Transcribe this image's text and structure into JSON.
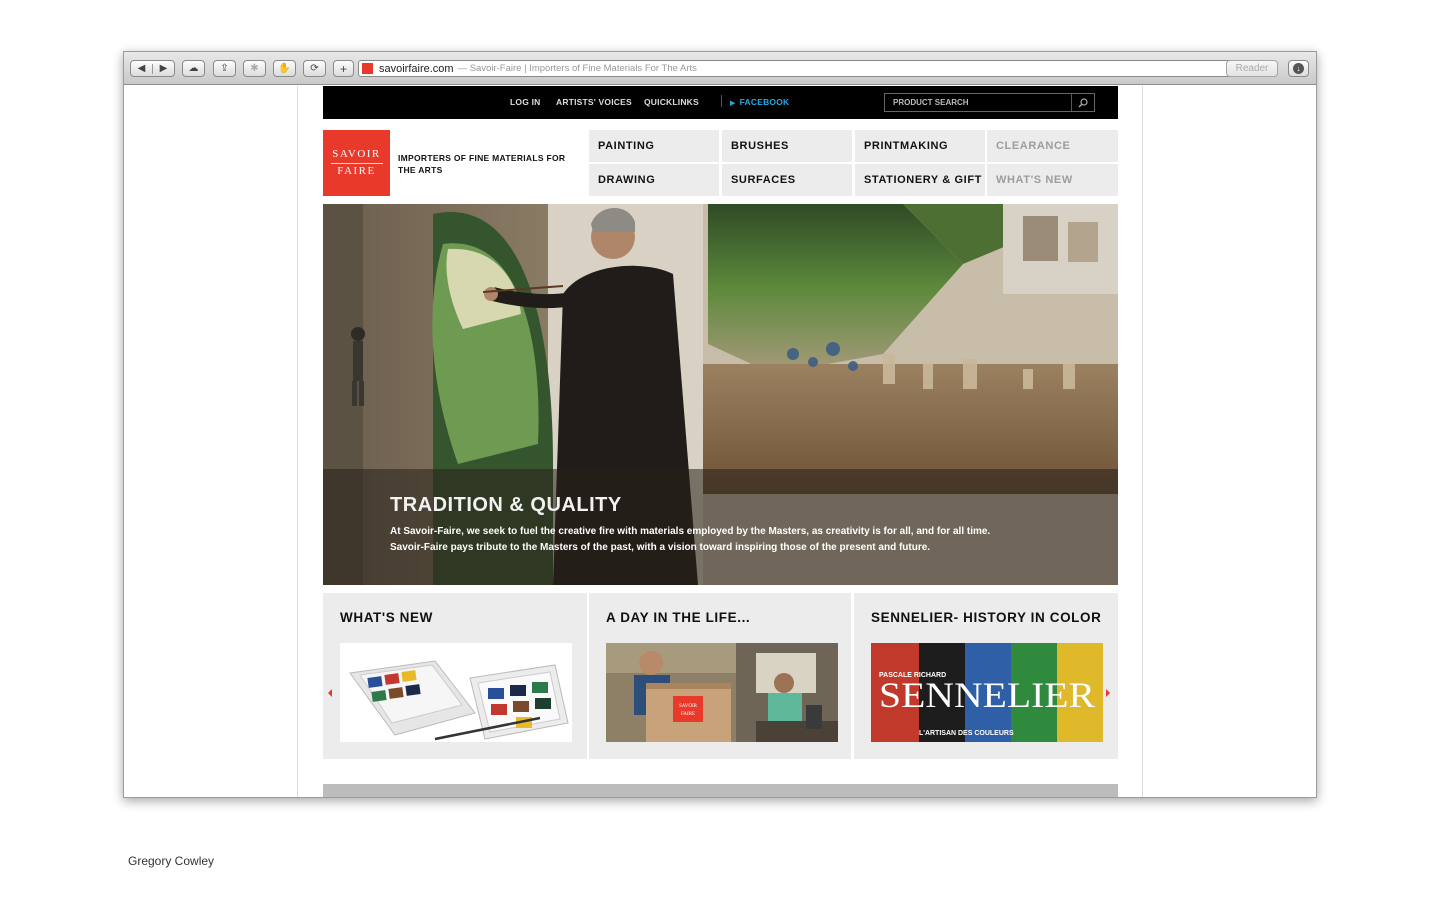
{
  "browser": {
    "address": {
      "domain": "savoirfaire.com",
      "title": "— Savoir-Faire  |  Importers of Fine Materials For The Arts"
    },
    "reader_label": "Reader",
    "icons": {
      "back": "back-arrow-icon",
      "forward": "forward-arrow-icon",
      "icloud": "cloud-icon",
      "share": "share-icon",
      "extensions": "puzzle-icon",
      "bookmarks": "hand-icon",
      "sync": "sync-icon",
      "add": "plus-icon",
      "reload": "reload-icon",
      "download": "download-icon"
    }
  },
  "site": {
    "topbar": {
      "links": [
        "LOG IN",
        "ARTISTS' VOICES",
        "QUICKLINKS"
      ],
      "facebook": "FACEBOOK",
      "search_placeholder": "PRODUCT SEARCH"
    },
    "logo": {
      "line1": "SAVOIR",
      "line2": "FAIRE"
    },
    "tagline": "IMPORTERS OF FINE MATERIALS FOR THE ARTS",
    "nav": [
      {
        "label": "PAINTING",
        "dim": false
      },
      {
        "label": "BRUSHES",
        "dim": false
      },
      {
        "label": "PRINTMAKING",
        "dim": false
      },
      {
        "label": "CLEARANCE",
        "dim": true
      },
      {
        "label": "DRAWING",
        "dim": false
      },
      {
        "label": "SURFACES",
        "dim": false
      },
      {
        "label": "STATIONERY & GIFT",
        "dim": false
      },
      {
        "label": "WHAT'S NEW",
        "dim": true
      }
    ],
    "hero": {
      "title": "TRADITION & QUALITY",
      "line1": "At Savoir-Faire, we seek to fuel the creative fire with materials employed by the Masters, as creativity is for all, and for all time.",
      "line2": "Savoir-Faire pays tribute to the Masters of the past, with a vision toward inspiring those of the present and future."
    },
    "features": [
      {
        "title": "WHAT'S NEW"
      },
      {
        "title": "A DAY IN THE LIFE..."
      },
      {
        "title": "SENNELIER- HISTORY IN COLOR"
      }
    ],
    "sennelier_banner": {
      "author": "PASCALE RICHARD",
      "name": "SENNELIER",
      "subtitle": "L'ARTISAN DES COULEURS"
    },
    "box_logo": {
      "line1": "SAVOIR",
      "line2": "FAIRE"
    }
  },
  "colors": {
    "brand_red": "#e8392b",
    "facebook_blue": "#29a8e0",
    "nav_bg": "#ececec"
  },
  "credit": "Gregory Cowley"
}
